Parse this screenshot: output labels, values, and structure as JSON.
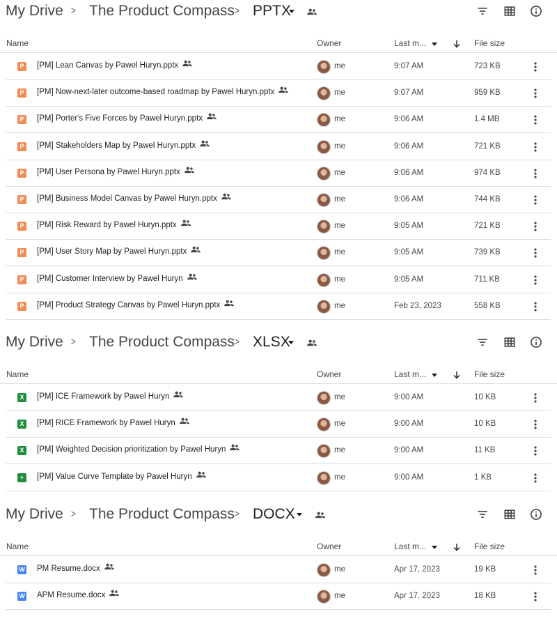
{
  "sections": [
    {
      "breadcrumb": {
        "root": "My Drive",
        "parent": "The Product Compass",
        "folder": "PPTX"
      },
      "columns": {
        "name": "Name",
        "owner": "Owner",
        "modified": "Last m...",
        "size": "File size"
      },
      "files": [
        {
          "type": "pptx",
          "name": "[PM] Lean Canvas by Pawel Huryn.pptx",
          "owner": "me",
          "modified": "9:07 AM",
          "size": "723 KB"
        },
        {
          "type": "pptx",
          "name": "[PM] Now-next-later outcome-based roadmap by Pawel Huryn.pptx",
          "owner": "me",
          "modified": "9:07 AM",
          "size": "959 KB"
        },
        {
          "type": "pptx",
          "name": "[PM] Porter's Five Forces by Pawel Huryn.pptx",
          "owner": "me",
          "modified": "9:06 AM",
          "size": "1.4 MB"
        },
        {
          "type": "pptx",
          "name": "[PM] Stakeholders Map by Pawel Huryn.pptx",
          "owner": "me",
          "modified": "9:06 AM",
          "size": "721 KB"
        },
        {
          "type": "pptx",
          "name": "[PM] User Persona by Pawel Huryn.pptx",
          "owner": "me",
          "modified": "9:06 AM",
          "size": "974 KB"
        },
        {
          "type": "pptx",
          "name": "[PM] Business Model Canvas by Pawel Huryn.pptx",
          "owner": "me",
          "modified": "9:06 AM",
          "size": "744 KB"
        },
        {
          "type": "pptx",
          "name": "[PM] Risk Reward by Pawel Huryn.pptx",
          "owner": "me",
          "modified": "9:05 AM",
          "size": "721 KB"
        },
        {
          "type": "pptx",
          "name": "[PM] User Story Map by Pawel Huryn.pptx",
          "owner": "me",
          "modified": "9:05 AM",
          "size": "739 KB"
        },
        {
          "type": "pptx",
          "name": "[PM] Customer Interview by Pawel Huryn",
          "owner": "me",
          "modified": "9:05 AM",
          "size": "711 KB"
        },
        {
          "type": "pptx",
          "name": "[PM] Product Strategy Canvas by Pawel Huryn.pptx",
          "owner": "me",
          "modified": "Feb 23, 2023",
          "size": "558 KB"
        }
      ]
    },
    {
      "breadcrumb": {
        "root": "My Drive",
        "parent": "The Product Compass",
        "folder": "XLSX"
      },
      "columns": {
        "name": "Name",
        "owner": "Owner",
        "modified": "Last m...",
        "size": "File size"
      },
      "files": [
        {
          "type": "xlsx",
          "name": "[PM] ICE Framework by Pawel Huryn",
          "owner": "me",
          "modified": "9:00 AM",
          "size": "10 KB"
        },
        {
          "type": "xlsx",
          "name": "[PM] RICE Framework by Pawel Huryn",
          "owner": "me",
          "modified": "9:00 AM",
          "size": "10 KB"
        },
        {
          "type": "xlsx",
          "name": "[PM] Weighted Decision prioritization by Pawel Huryn",
          "owner": "me",
          "modified": "9:00 AM",
          "size": "11 KB"
        },
        {
          "type": "sheet",
          "name": "[PM] Value Curve Template by Pawel Huryn",
          "owner": "me",
          "modified": "9:00 AM",
          "size": "1 KB"
        }
      ]
    },
    {
      "breadcrumb": {
        "root": "My Drive",
        "parent": "The Product Compass",
        "folder": "DOCX"
      },
      "columns": {
        "name": "Name",
        "owner": "Owner",
        "modified": "Last m...",
        "size": "File size"
      },
      "files": [
        {
          "type": "docx",
          "name": "PM Resume.docx",
          "owner": "me",
          "modified": "Apr 17, 2023",
          "size": "19 KB"
        },
        {
          "type": "docx",
          "name": "APM Resume.docx",
          "owner": "me",
          "modified": "Apr 17, 2023",
          "size": "18 KB"
        }
      ]
    }
  ],
  "file_icon_letters": {
    "pptx": "P",
    "xlsx": "X",
    "sheet": "+",
    "docx": "W"
  },
  "icons": {
    "file_type": {
      "pptx": "powerpoint-icon",
      "xlsx": "excel-icon",
      "sheet": "sheets-icon",
      "docx": "word-icon"
    },
    "shared": "shared-people-icon",
    "more": "more-vert-icon",
    "filter": "filter-icon",
    "grid": "grid-view-icon",
    "info": "info-icon"
  },
  "colors": {
    "pptx": "#f28b54",
    "xlsx": "#1e8e3e",
    "docx": "#4285f4",
    "divider": "#dadce0"
  }
}
